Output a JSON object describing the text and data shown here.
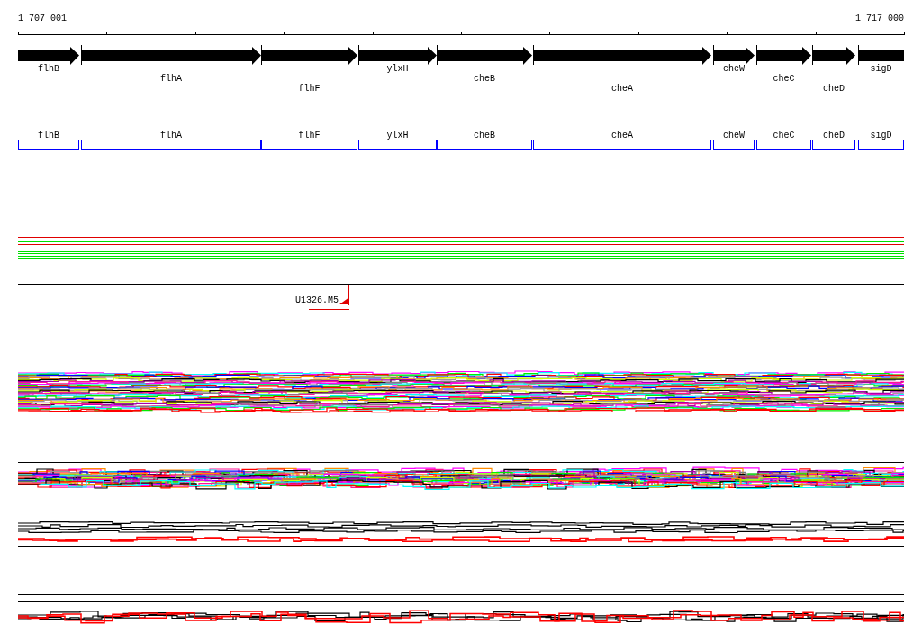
{
  "ruler": {
    "start_label": "1 707 001",
    "end_label": "1 717 000"
  },
  "gene_track": {
    "genes": [
      {
        "name": "flhB"
      },
      {
        "name": "flhA"
      },
      {
        "name": "flhF"
      },
      {
        "name": "ylxH"
      },
      {
        "name": "cheB"
      },
      {
        "name": "cheA"
      },
      {
        "name": "cheW"
      },
      {
        "name": "cheC"
      },
      {
        "name": "cheD"
      },
      {
        "name": "sigD"
      }
    ]
  },
  "cds_track": {
    "genes": [
      {
        "name": "flhB"
      },
      {
        "name": "flhA"
      },
      {
        "name": "flhF"
      },
      {
        "name": "ylxH"
      },
      {
        "name": "cheB"
      },
      {
        "name": "cheA"
      },
      {
        "name": "cheW"
      },
      {
        "name": "cheC"
      },
      {
        "name": "cheD"
      },
      {
        "name": "sigD"
      }
    ]
  },
  "marker": {
    "label": "U1326.M5"
  }
}
